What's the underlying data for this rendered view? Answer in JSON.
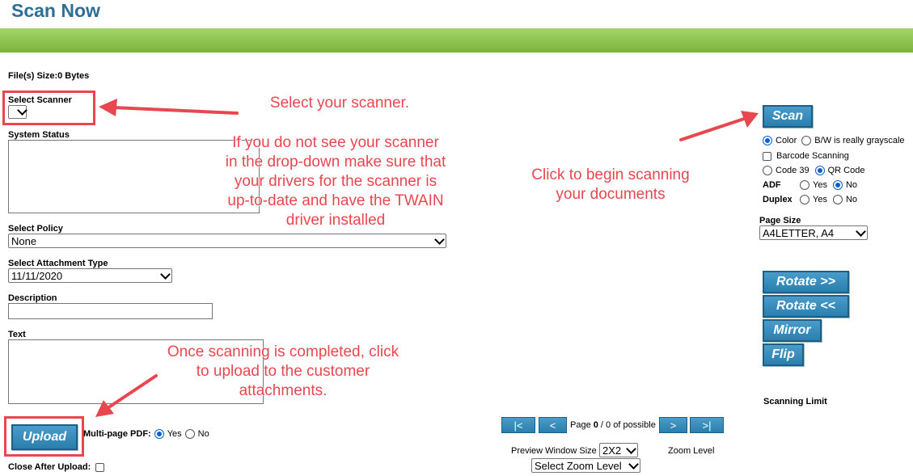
{
  "page": {
    "title": "Scan Now"
  },
  "file_size": "File(s) Size:0 Bytes",
  "select_scanner": {
    "label": "Select Scanner",
    "value": ""
  },
  "system_status": {
    "label": "System Status"
  },
  "select_policy": {
    "label": "Select Policy",
    "value": "None"
  },
  "attachment_type": {
    "label": "Select Attachment Type",
    "value": "11/11/2020"
  },
  "description": {
    "label": "Description",
    "value": ""
  },
  "text_field": {
    "label": "Text"
  },
  "upload": {
    "label": "Upload"
  },
  "multipage": {
    "label": "Multi-page PDF:",
    "yes": "Yes",
    "no": "No",
    "selected": "Yes"
  },
  "close_after_upload": {
    "label": "Close After Upload:"
  },
  "scan": {
    "label": "Scan"
  },
  "color_mode": {
    "color": "Color",
    "bw": "B/W is really grayscale",
    "selected": "Color"
  },
  "barcode": {
    "label": "Barcode Scanning"
  },
  "code_type": {
    "code39": "Code 39",
    "qr": "QR Code",
    "selected": "QR Code"
  },
  "adf": {
    "label": "ADF",
    "yes": "Yes",
    "no": "No",
    "selected": "No"
  },
  "duplex": {
    "label": "Duplex",
    "yes": "Yes",
    "no": "No"
  },
  "page_size": {
    "label": "Page Size",
    "value": "A4LETTER, A4"
  },
  "transform": {
    "rotate_right": "Rotate >>",
    "rotate_left": "Rotate <<",
    "mirror": "Mirror",
    "flip": "Flip"
  },
  "scanning_limit": "Scanning Limit",
  "pager": {
    "first": "|<",
    "prev": "<",
    "next": ">",
    "last": ">|",
    "text_pre": "Page ",
    "current": "0",
    "text_post": " / 0 of possible"
  },
  "preview_window": {
    "label": "Preview Window Size",
    "value": "2X2"
  },
  "zoom": {
    "label": "Zoom Level",
    "value": "Select Zoom Level"
  },
  "annotations": {
    "select_scanner": "Select your scanner.",
    "driver_note": [
      "If you do not see your scanner",
      "in the drop-down make sure that",
      "your drivers for the scanner is",
      "up-to-date and have the TWAIN",
      "driver installed"
    ],
    "scan_note": [
      "Click to begin scanning",
      "your documents"
    ],
    "upload_note": [
      "Once scanning is completed, click",
      "to upload to the customer",
      "attachments."
    ]
  },
  "colors": {
    "accent": "#2a7fae",
    "title": "#2f6f96",
    "annotation": "#e8474f",
    "bar": "#8fc24d"
  }
}
